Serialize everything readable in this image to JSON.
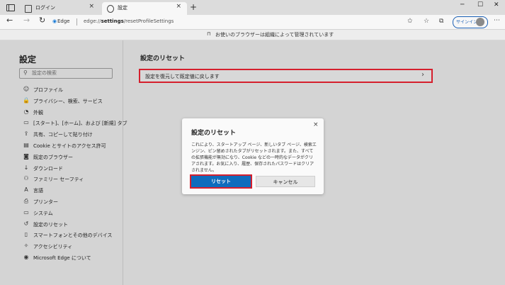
{
  "browser": {
    "tabs": [
      {
        "label": "ログイン",
        "close": "×"
      },
      {
        "label": "設定",
        "close": "×"
      }
    ],
    "new_tab": "+",
    "window_controls": [
      "─",
      "☐",
      "✕"
    ],
    "nav": {
      "back": "←",
      "forward": "→",
      "refresh": "↻"
    },
    "address": {
      "site_label": "Edge",
      "url_prefix": "edge://",
      "url_bold": "settings",
      "url_rest": "/resetProfileSettings"
    },
    "signin_label": "サインイン"
  },
  "managed_notice": "お使いのブラウザーは組織によって管理されています",
  "sidebar": {
    "title": "設定",
    "search_placeholder": "設定の検索",
    "items": [
      {
        "label": "プロファイル",
        "icon": "person-icon",
        "glyph": "☺"
      },
      {
        "label": "プライバシー、検索、サービス",
        "icon": "lock-icon",
        "glyph": "🔒"
      },
      {
        "label": "外観",
        "icon": "appearance-icon",
        "glyph": "◔"
      },
      {
        "label": "[スタート]、[ホーム]、および [新規] タブ",
        "icon": "home-tab-icon",
        "glyph": "▭"
      },
      {
        "label": "共有、コピーして貼り付け",
        "icon": "share-icon",
        "glyph": "⇪"
      },
      {
        "label": "Cookie とサイトのアクセス許可",
        "icon": "site-permissions-icon",
        "glyph": "▤"
      },
      {
        "label": "既定のブラウザー",
        "icon": "default-browser-icon",
        "glyph": "◙"
      },
      {
        "label": "ダウンロード",
        "icon": "download-icon",
        "glyph": "↓"
      },
      {
        "label": "ファミリー セーフティ",
        "icon": "family-icon",
        "glyph": "⚇"
      },
      {
        "label": "言語",
        "icon": "language-icon",
        "glyph": "A"
      },
      {
        "label": "プリンター",
        "icon": "printer-icon",
        "glyph": "⎙"
      },
      {
        "label": "システム",
        "icon": "system-icon",
        "glyph": "▭"
      },
      {
        "label": "設定のリセット",
        "icon": "reset-icon",
        "glyph": "↺"
      },
      {
        "label": "スマートフォンとその他のデバイス",
        "icon": "phone-icon",
        "glyph": "▯"
      },
      {
        "label": "アクセシビリティ",
        "icon": "accessibility-icon",
        "glyph": "✧"
      },
      {
        "label": "Microsoft Edge について",
        "icon": "edge-logo-icon",
        "glyph": "◉"
      }
    ]
  },
  "content": {
    "title": "設定のリセット",
    "reset_row_label": "設定を復元して既定値に戻します",
    "chevron": "›"
  },
  "dialog": {
    "title": "設定のリセット",
    "close": "×",
    "body": "これにより、スタートアップ ページ、新しいタブ ページ、検索エンジン、ピン留めされたタブがリセットされます。また、すべての拡張機能が無効になり、Cookie などの一時的なデータがクリアされます。お気に入り、履歴、保存されたパスワードはクリアされません。",
    "reset_button": "リセット",
    "cancel_button": "キャンセル"
  },
  "colors": {
    "accent": "#0f6cbd",
    "highlight": "#d51f2d"
  }
}
